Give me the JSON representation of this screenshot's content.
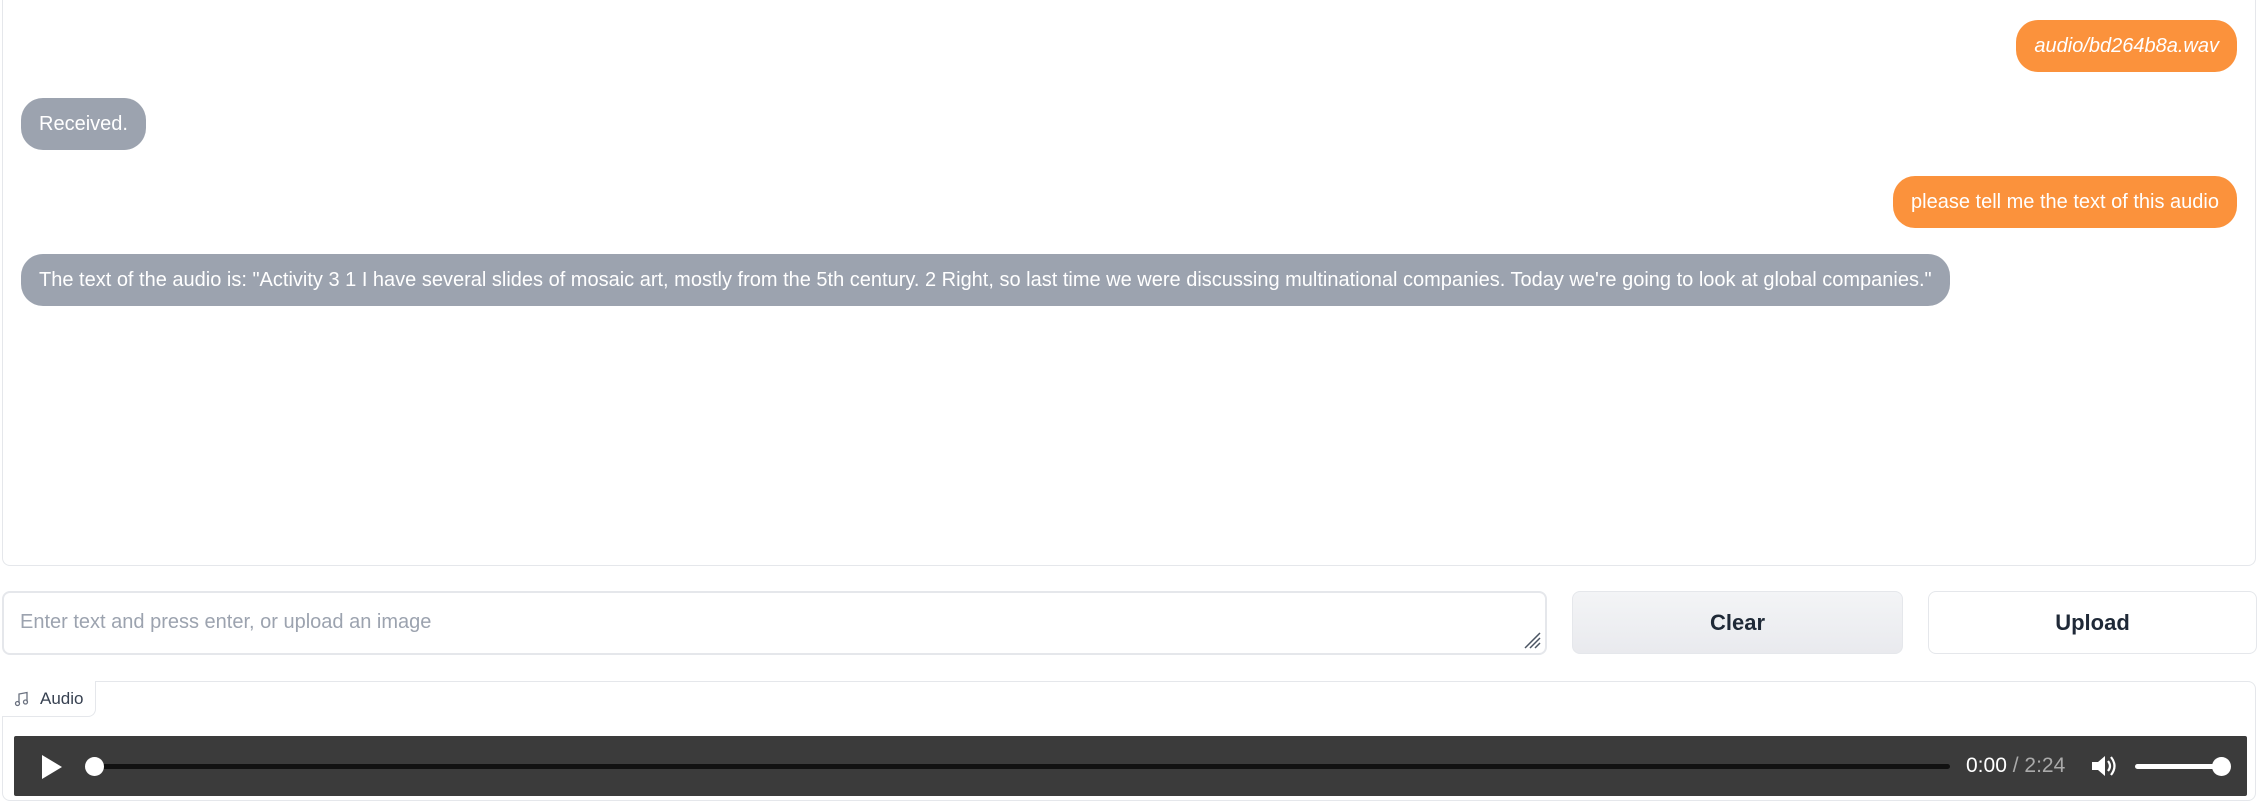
{
  "chat": {
    "messages": [
      {
        "role": "user",
        "text": "audio/bd264b8a.wav"
      },
      {
        "role": "bot",
        "text": "Received."
      },
      {
        "role": "user",
        "text": "please tell me the text of this audio"
      },
      {
        "role": "bot",
        "text": "The text of the audio is: \"Activity 3 1 I have several slides of mosaic art, mostly from the 5th century. 2 Right, so last time we were discussing multinational companies. Today we're going to look at global companies.\""
      }
    ]
  },
  "input": {
    "placeholder": "Enter text and press enter, or upload an image",
    "value": ""
  },
  "buttons": {
    "clear_label": "Clear",
    "upload_label": "Upload"
  },
  "audio": {
    "label": "Audio",
    "label_icon": "music-note-icon",
    "current_time": "0:00",
    "separator": "/",
    "duration": "2:24",
    "progress_fraction": 0.0,
    "volume_fraction": 1.0
  },
  "colors": {
    "user_bubble": "#fb923c",
    "bot_bubble": "#9ca3af",
    "player_bg": "#3b3b3b"
  }
}
